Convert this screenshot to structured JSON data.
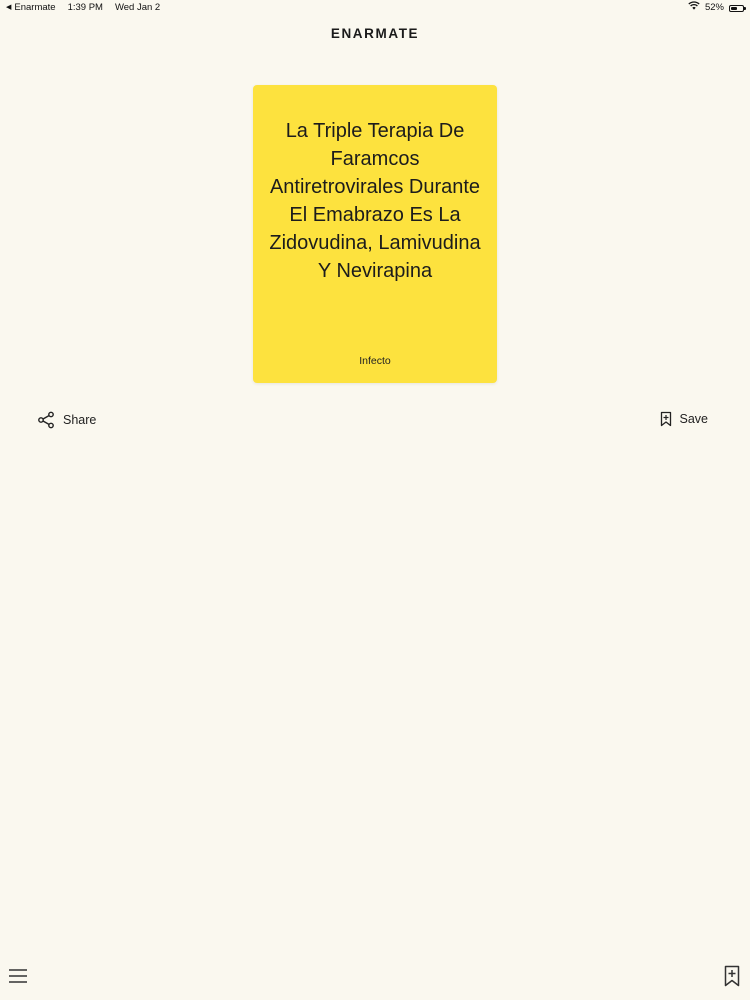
{
  "status_bar": {
    "back_app": "Enarmate",
    "time": "1:39 PM",
    "date": "Wed Jan 2",
    "battery_text": "52%",
    "battery_level": 0.52
  },
  "header": {
    "title": "ENARMATE"
  },
  "card": {
    "text": "La Triple Terapia De Faramcos Antiretrovirales Durante El Emabrazo Es La Zidovudina, Lamivudina Y Nevirapina",
    "category": "Infecto",
    "color": "#fde23e"
  },
  "actions": {
    "share_label": "Share",
    "save_label": "Save"
  },
  "icons": {
    "back": "back-arrow-icon",
    "wifi": "wifi-icon",
    "battery": "battery-icon",
    "share": "share-icon",
    "save": "bookmark-icon",
    "menu": "hamburger-menu-icon",
    "add_bookmark": "bookmark-add-icon"
  },
  "colors": {
    "background": "#faf8ef",
    "card": "#fde23e",
    "text": "#1c1c1c"
  }
}
